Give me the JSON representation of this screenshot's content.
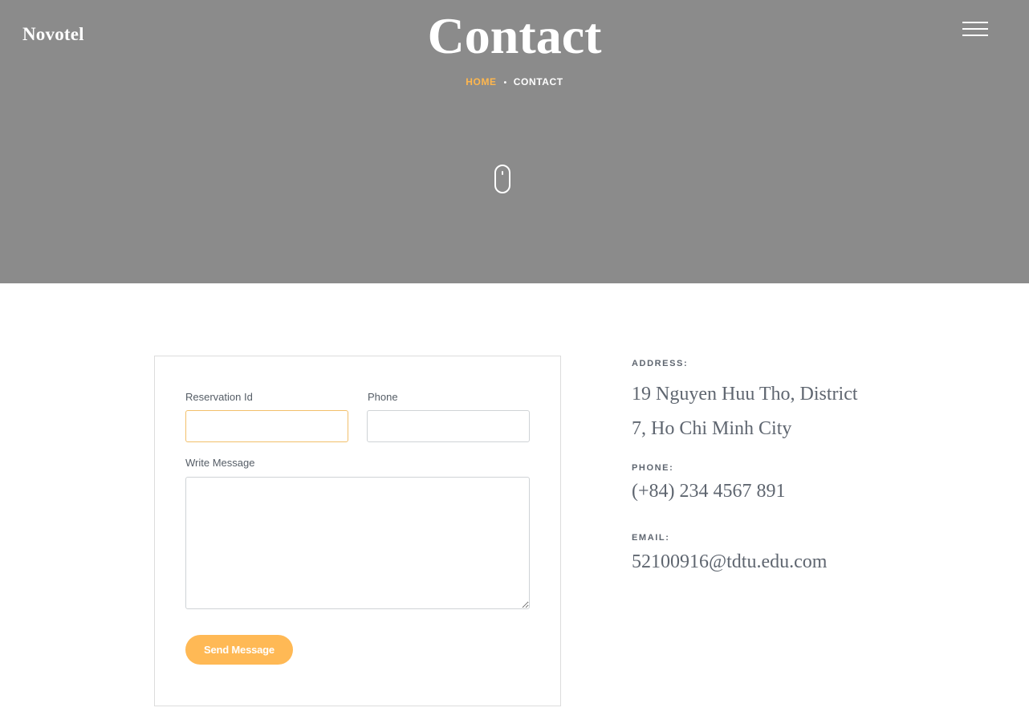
{
  "header": {
    "logo": "Novotel",
    "title": "Contact",
    "breadcrumb": {
      "home": "HOME",
      "separator": "•",
      "current": "CONTACT"
    },
    "menu_icon": "hamburger-icon",
    "scroll_icon": "mouse-scroll-icon"
  },
  "form": {
    "reservation_label": "Reservation Id",
    "reservation_value": "",
    "phone_label": "Phone",
    "phone_value": "",
    "message_label": "Write Message",
    "message_value": "",
    "submit_label": "Send Message"
  },
  "contact_info": {
    "address_label": "ADDRESS:",
    "address_value": "19 Nguyen Huu Tho, District 7, Ho Chi Minh City",
    "phone_label": "PHONE:",
    "phone_value": "(+84) 234 4567 891",
    "email_label": "EMAIL:",
    "email_value": "52100916@tdtu.edu.com"
  },
  "colors": {
    "hero_background": "#8b8b8b",
    "accent": "#ffb955",
    "breadcrumb_home": "#ffb74d",
    "text_muted": "#5f6670",
    "focus_border": "#f2c06b"
  }
}
